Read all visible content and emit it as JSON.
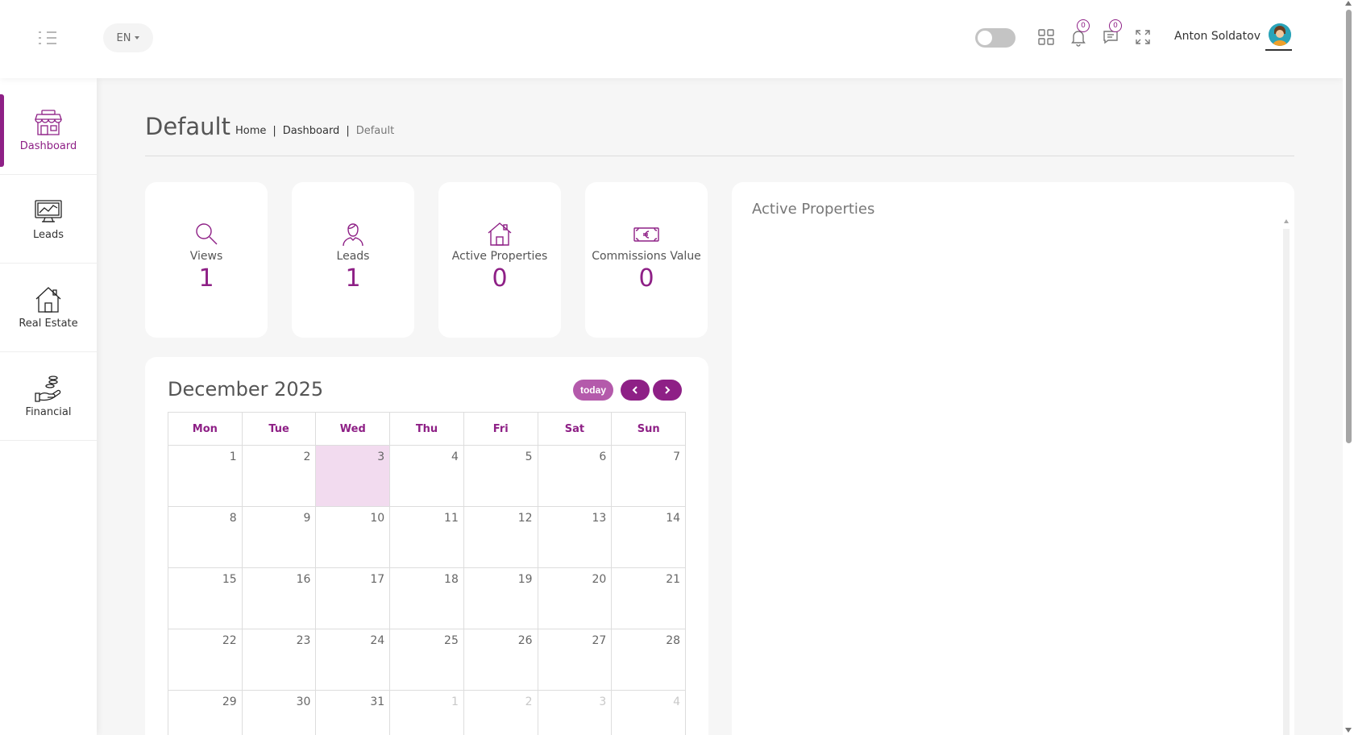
{
  "header": {
    "language": "EN",
    "user_name": "Anton Soldatov",
    "notifications_count": "0",
    "messages_count": "0"
  },
  "sidebar": {
    "items": [
      {
        "label": "Dashboard",
        "icon": "store-icon",
        "active": true
      },
      {
        "label": "Leads",
        "icon": "monitor-chart-icon",
        "active": false
      },
      {
        "label": "Real Estate",
        "icon": "house-icon",
        "active": false
      },
      {
        "label": "Financial",
        "icon": "hand-coins-icon",
        "active": false
      }
    ]
  },
  "page": {
    "title": "Default",
    "breadcrumb": [
      "Home",
      "Dashboard",
      "Default"
    ],
    "separator": "|"
  },
  "stats": [
    {
      "label": "Views",
      "value": "1",
      "icon": "search-icon"
    },
    {
      "label": "Leads",
      "value": "1",
      "icon": "user-icon"
    },
    {
      "label": "Active Properties",
      "value": "0",
      "icon": "house-icon"
    },
    {
      "label": "Commissions Value",
      "value": "0",
      "icon": "euro-banknote-icon"
    }
  ],
  "calendar": {
    "title": "December 2025",
    "today_label": "today",
    "weekdays": [
      "Mon",
      "Tue",
      "Wed",
      "Thu",
      "Fri",
      "Sat",
      "Sun"
    ],
    "weeks": [
      [
        "1",
        "2",
        "3",
        "4",
        "5",
        "6",
        "7"
      ],
      [
        "8",
        "9",
        "10",
        "11",
        "12",
        "13",
        "14"
      ],
      [
        "15",
        "16",
        "17",
        "18",
        "19",
        "20",
        "21"
      ],
      [
        "22",
        "23",
        "24",
        "25",
        "26",
        "27",
        "28"
      ],
      [
        "29",
        "30",
        "31",
        "1",
        "2",
        "3",
        "4"
      ]
    ],
    "today_date": "3"
  },
  "active_properties": {
    "title": "Active Properties"
  },
  "colors": {
    "accent": "#8e2086",
    "accent_light": "#b45aab",
    "today_bg": "#f2dbef"
  }
}
